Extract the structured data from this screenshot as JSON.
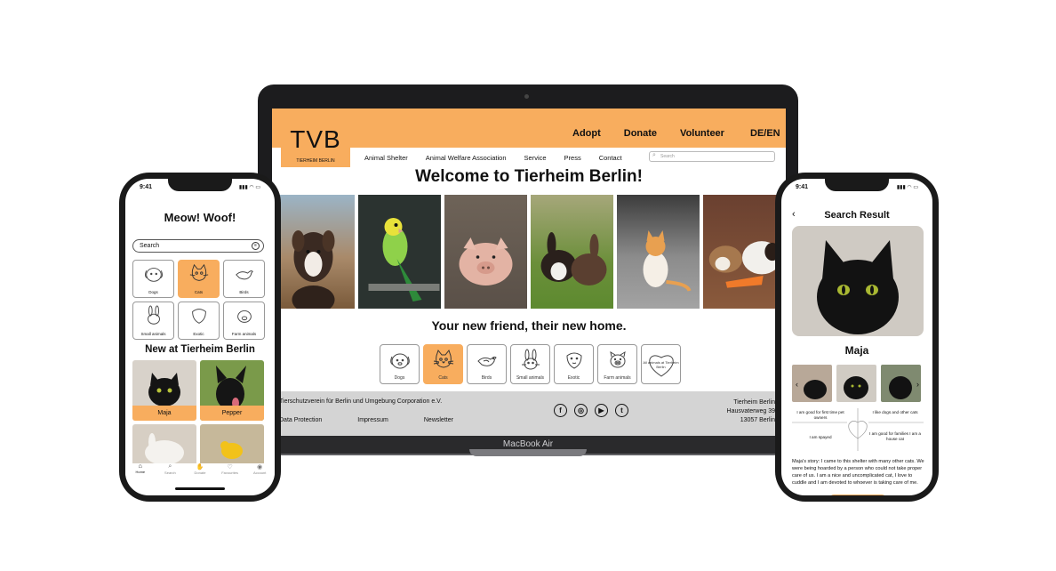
{
  "colors": {
    "brand_orange": "#f8ad5e",
    "footer_gray": "#d4d4d4",
    "device_black": "#1c1c1e"
  },
  "laptop": {
    "device_label": "MacBook Air",
    "site": {
      "logo": "TVB",
      "logo_sub": "TIERHEIM BERLIN",
      "top_nav": [
        "Adopt",
        "Donate",
        "Volunteer"
      ],
      "language": "DE/EN",
      "sub_nav": [
        "Animal Shelter",
        "Animal Welfare Association",
        "Service",
        "Press",
        "Contact"
      ],
      "search_placeholder": "Search",
      "welcome": "Welcome to Tierheim Berlin!",
      "tagline": "Your new friend, their new home.",
      "categories": [
        {
          "label": "Dogs",
          "icon": "dog-icon"
        },
        {
          "label": "Cats",
          "icon": "cat-icon"
        },
        {
          "label": "Birds",
          "icon": "bird-icon"
        },
        {
          "label": "Small animals",
          "icon": "rabbit-icon"
        },
        {
          "label": "Exotic",
          "icon": "reptile-icon"
        },
        {
          "label": "Farm animals",
          "icon": "pig-icon"
        }
      ],
      "heart_tile": "All animals at Tierheim Berlin",
      "footer": {
        "org": "Tierschutzverein für Berlin und Umgebung Corporation e.V.",
        "links": [
          "Data Protection",
          "Impressum",
          "Newsletter"
        ],
        "social": [
          {
            "glyph": "f",
            "icon": "facebook-icon"
          },
          {
            "glyph": "◎",
            "icon": "instagram-icon"
          },
          {
            "glyph": "▶",
            "icon": "youtube-icon"
          },
          {
            "glyph": "t",
            "icon": "twitter-icon"
          }
        ],
        "address": [
          "Tierheim Berlin",
          "Hausvaterweg 39",
          "13057 Berlin"
        ]
      }
    }
  },
  "phone_left": {
    "time": "9:41",
    "status": "▮▮▮ ◠ ▭",
    "title": "Meow! Woof!",
    "search_placeholder": "Search",
    "filter_glyph": "≡",
    "categories": [
      {
        "label": "Dogs"
      },
      {
        "label": "Cats"
      },
      {
        "label": "Birds"
      },
      {
        "label": "Small animals"
      },
      {
        "label": "Exotic"
      },
      {
        "label": "Farm animals"
      }
    ],
    "section_title": "New at Tierheim Berlin",
    "animals": [
      "Maja",
      "Pepper"
    ],
    "tabs": [
      {
        "label": "Home",
        "glyph": "⌂"
      },
      {
        "label": "Search",
        "glyph": "⌕"
      },
      {
        "label": "Donate",
        "glyph": "✋"
      },
      {
        "label": "Favourites",
        "glyph": "♡"
      },
      {
        "label": "Account",
        "glyph": "◉"
      }
    ]
  },
  "phone_right": {
    "time": "9:41",
    "status": "▮▮▮ ◠ ▭",
    "back_glyph": "‹",
    "title": "Search Result",
    "name": "Maja",
    "arrow_left": "‹",
    "arrow_right": "›",
    "traits": [
      "I am good for first time pet owners",
      "I like dogs and other cats",
      "I am spayed",
      "I am good for families I am a house cat"
    ],
    "story": "Maja's story: I came to this shelter with many other cats. We were being hoarded by a person who could not take proper care of us. I am a nice and uncomplicated cat, I love to cuddle and I am devoted to whoever is taking care of me."
  }
}
